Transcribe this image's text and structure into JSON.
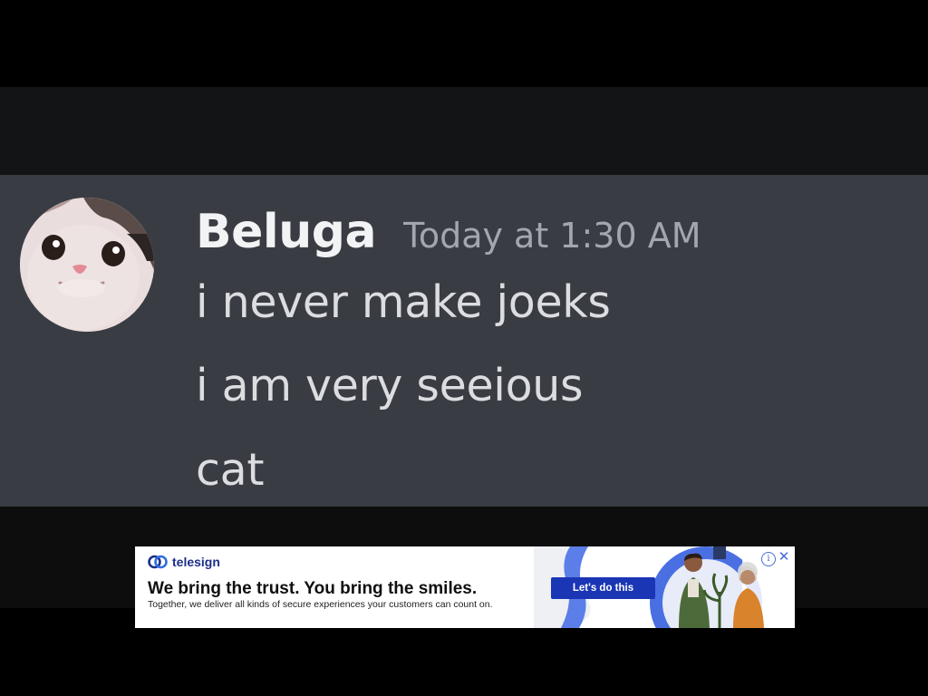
{
  "message": {
    "username": "Beluga",
    "timestamp": "Today at 1:30 AM",
    "lines": [
      "i never make joeks",
      "i am very seeious",
      "cat"
    ],
    "avatar_icon": "cat-avatar"
  },
  "colors": {
    "panel_bg": "#3a3c43",
    "username": "#f2f3f5",
    "timestamp": "#a3a6ad",
    "message_text": "#dcdde1",
    "ad_cta": "#1a36b5"
  },
  "ad": {
    "brand": "telesign",
    "headline": "We bring the trust. You bring the smiles.",
    "subtext": "Together, we deliver all kinds of secure experiences your customers can count on.",
    "cta_label": "Let's do this",
    "info_glyph": "i",
    "close_glyph": "✕",
    "logo_icon": "telesign-logo-icon"
  }
}
